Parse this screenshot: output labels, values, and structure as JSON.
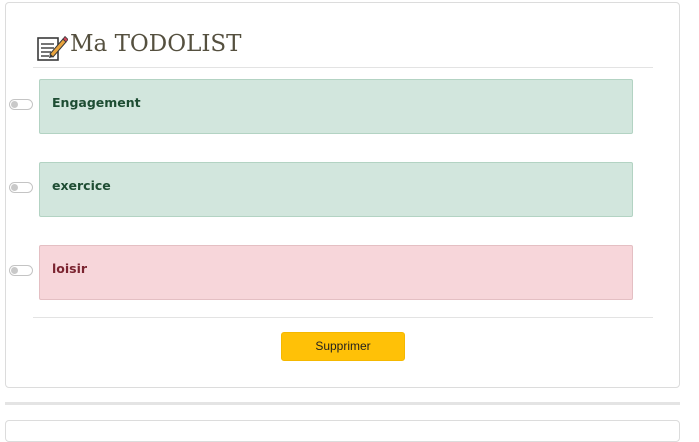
{
  "header": {
    "title": "Ma TODOLIST",
    "logo_icon": "memo-pencil-icon"
  },
  "todos": [
    {
      "label": "Engagement",
      "status": "green",
      "checked": false
    },
    {
      "label": "exercice",
      "status": "green",
      "checked": false
    },
    {
      "label": "loisir",
      "status": "red",
      "checked": false
    }
  ],
  "actions": {
    "delete_label": "Supprimer"
  },
  "colors": {
    "accent": "#ffc107",
    "green_bg": "#d2e6dd",
    "red_bg": "#f7d6da",
    "title": "#55503f"
  }
}
